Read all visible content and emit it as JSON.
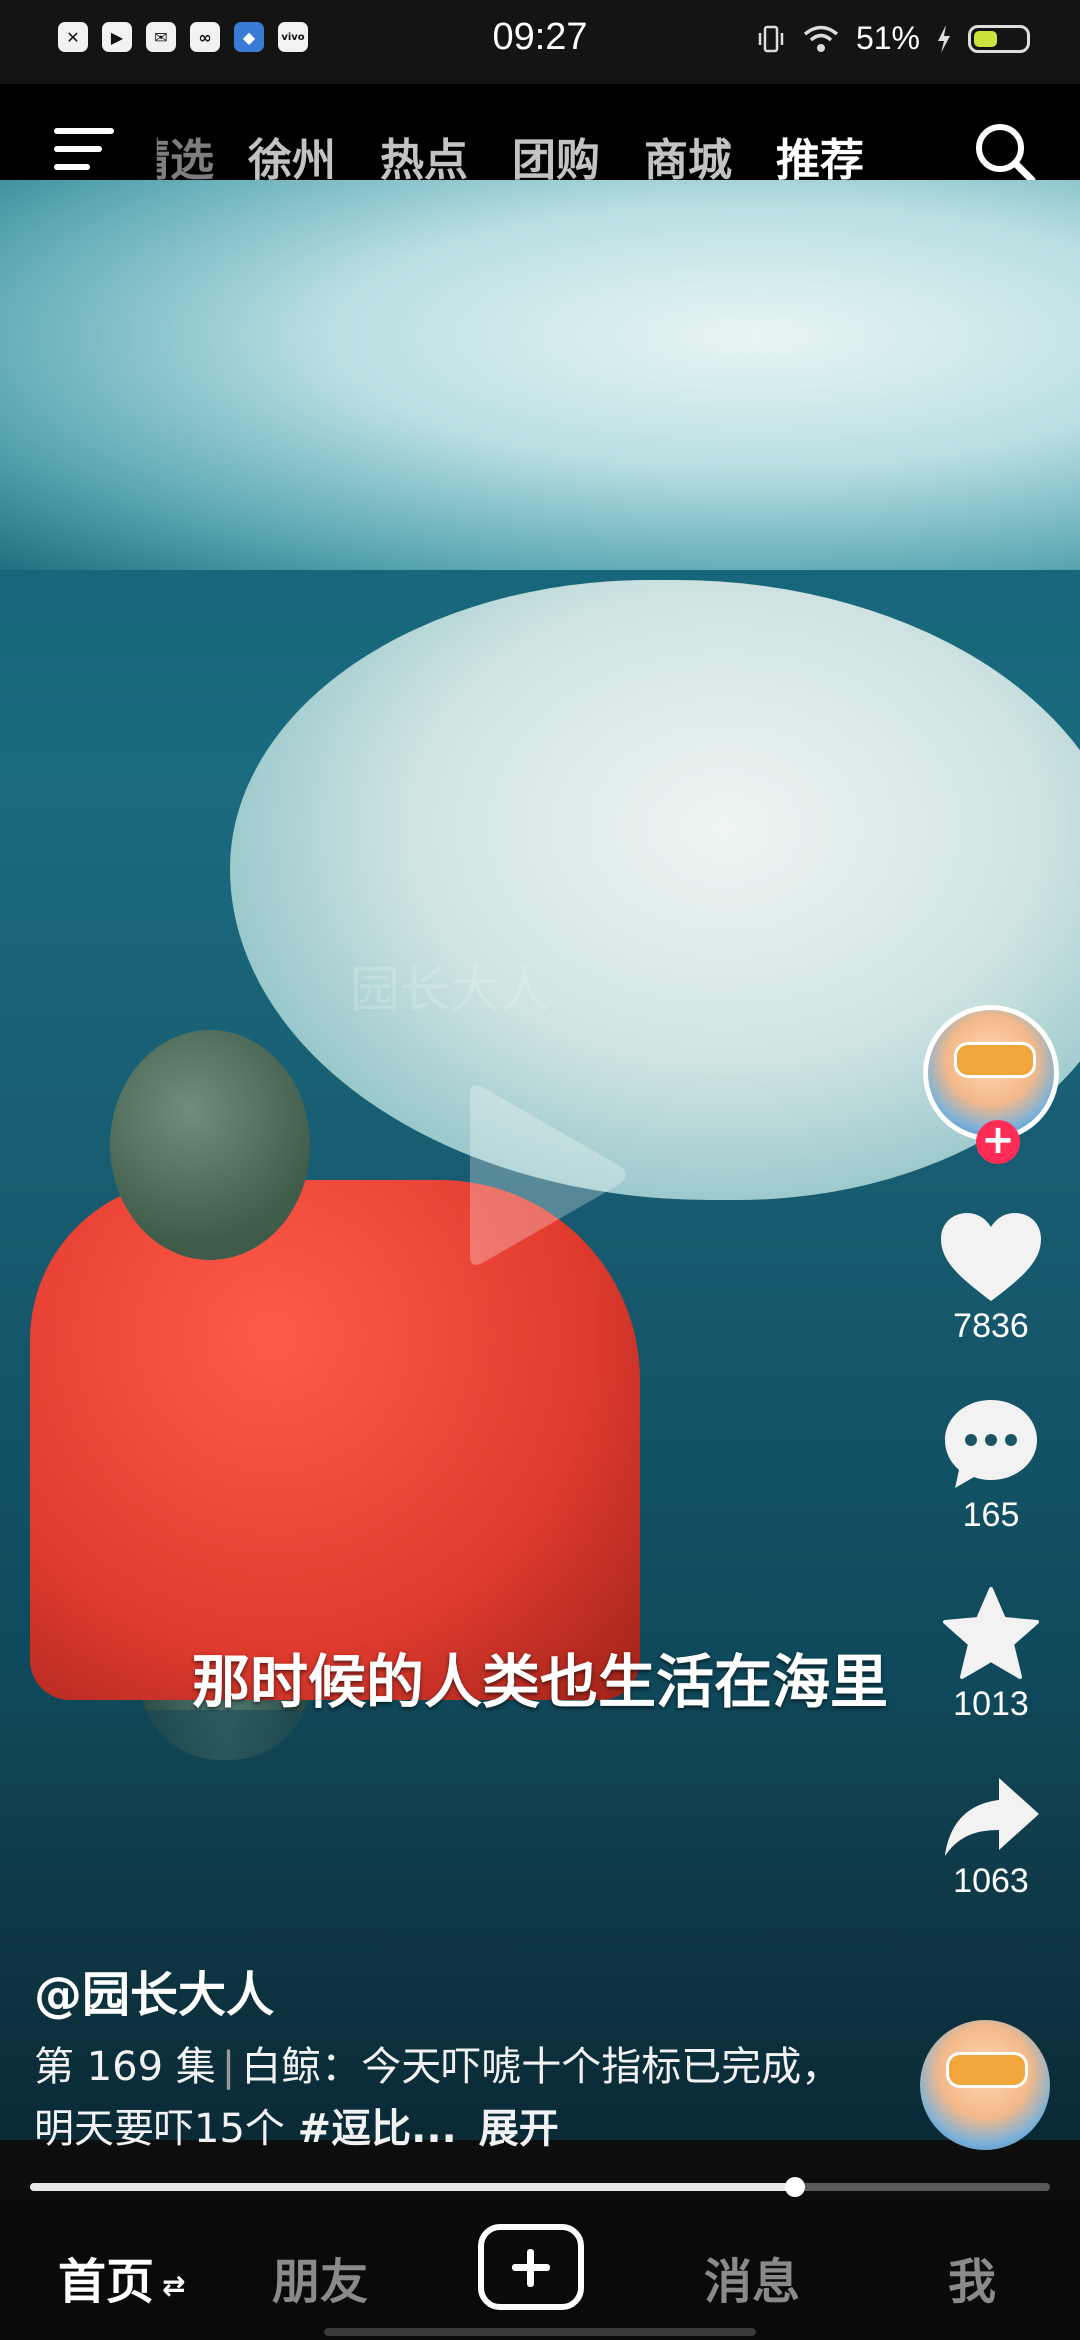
{
  "status_bar": {
    "time": "09:27",
    "battery": "51%",
    "battery_level": 0.51,
    "left_icons": [
      "x-box-icon",
      "play-icon",
      "mail-icon",
      "link-icon",
      "app-icon",
      "vivo-icon"
    ],
    "right_icons": [
      "vibrate-icon",
      "wifi-icon",
      "charging-icon"
    ]
  },
  "top_nav": {
    "tabs": [
      {
        "label": "精选"
      },
      {
        "label": "徐州"
      },
      {
        "label": "热点"
      },
      {
        "label": "团购"
      },
      {
        "label": "商城"
      },
      {
        "label": "推荐",
        "active": true
      }
    ]
  },
  "video": {
    "watermark": "园长大人",
    "subtitle": "那时候的人类也生活在海里",
    "progress": 0.75
  },
  "rail": {
    "likes": "7836",
    "comments": "165",
    "favorites": "1013",
    "shares": "1063"
  },
  "caption": {
    "author": "@园长大人",
    "episode": "第 169 集",
    "text": "白鲸：今天吓唬十个指标已完成，明天要吓15个",
    "tag": "#逗比...",
    "more": "展开"
  },
  "bottom_nav": {
    "home": "首页",
    "friends": "朋友",
    "messages": "消息",
    "me": "我"
  }
}
